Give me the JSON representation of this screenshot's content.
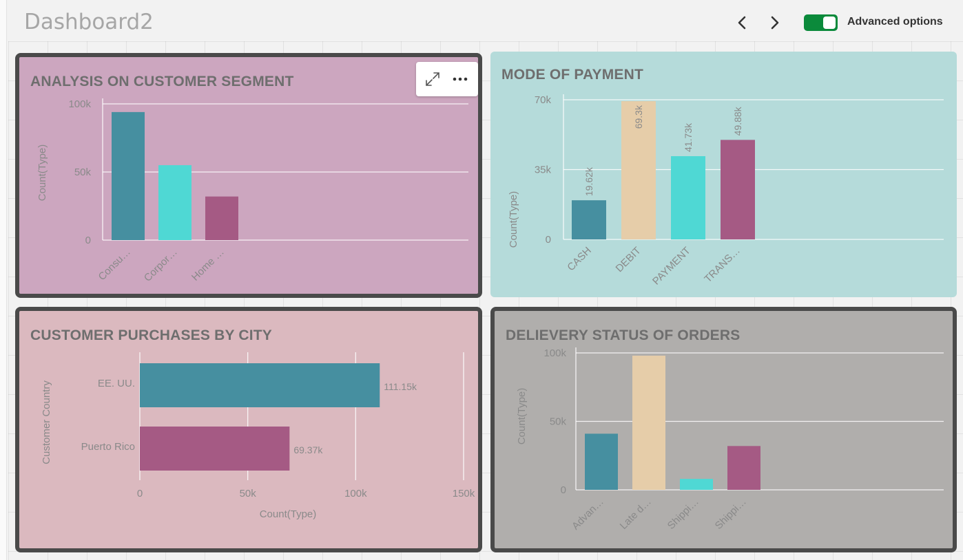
{
  "app": {
    "title": "Dashboard2",
    "advanced_options_label": "Advanced options",
    "advanced_options_on": true,
    "toggle_color": "#0b8a3b",
    "nav": {
      "prev_icon": "chevron-left-icon",
      "next_icon": "chevron-right-icon"
    }
  },
  "toolbar": {
    "expand_icon": "expand-icon",
    "more_icon": "more-horizontal-icon"
  },
  "panels": [
    {
      "id": "customer-segment",
      "title": "ANALYSIS ON CUSTOMER SEGMENT",
      "background": "#cca6bf",
      "selected": true,
      "chart_data": {
        "type": "bar",
        "title": "ANALYSIS ON CUSTOMER SEGMENT",
        "categories": [
          "Consu…",
          "Corpor…",
          "Home …"
        ],
        "values": [
          94000,
          55000,
          32000
        ],
        "colors": [
          "#468fa0",
          "#4fd8d4",
          "#a55a84"
        ],
        "ylabel": "Count(Type)",
        "xlabel": "",
        "ylim": [
          0,
          100000
        ],
        "yticks": [
          {
            "v": 0,
            "label": "0"
          },
          {
            "v": 50000,
            "label": "50k"
          },
          {
            "v": 100000,
            "label": "100k"
          }
        ],
        "data_labels": []
      }
    },
    {
      "id": "mode-of-payment",
      "title": "MODE OF PAYMENT",
      "background": "#b5dbda",
      "selected": false,
      "chart_data": {
        "type": "bar",
        "title": "MODE OF PAYMENT",
        "categories": [
          "CASH",
          "DEBIT",
          "PAYMENT",
          "TRANS…"
        ],
        "values": [
          19620,
          69300,
          41730,
          49880
        ],
        "colors": [
          "#468fa0",
          "#e6cda9",
          "#4fd8d4",
          "#a55a84"
        ],
        "ylabel": "Count(Type)",
        "xlabel": "",
        "ylim": [
          0,
          70000
        ],
        "yticks": [
          {
            "v": 0,
            "label": "0"
          },
          {
            "v": 35000,
            "label": "35k"
          },
          {
            "v": 70000,
            "label": "70k"
          }
        ],
        "data_labels": [
          "19.62k",
          "69.3k",
          "41.73k",
          "49.88k"
        ]
      }
    },
    {
      "id": "purchases-by-city",
      "title": "CUSTOMER PURCHASES BY CITY",
      "background": "#dbb9bf",
      "selected": true,
      "chart_data": {
        "type": "bar",
        "orientation": "horizontal",
        "title": "CUSTOMER PURCHASES BY CITY",
        "categories": [
          "EE. UU.",
          "Puerto Rico"
        ],
        "values": [
          111150,
          69370
        ],
        "colors": [
          "#468fa0",
          "#a55a84"
        ],
        "ylabel": "Customer Country",
        "xlabel": "Count(Type)",
        "xlim": [
          0,
          150000
        ],
        "xticks": [
          {
            "v": 0,
            "label": "0"
          },
          {
            "v": 50000,
            "label": "50k"
          },
          {
            "v": 100000,
            "label": "100k"
          },
          {
            "v": 150000,
            "label": "150k"
          }
        ],
        "data_labels": [
          "111.15k",
          "69.37k"
        ]
      }
    },
    {
      "id": "delivery-status",
      "title": "DELIEVERY STATUS OF ORDERS",
      "background": "#b0aeac",
      "selected": true,
      "chart_data": {
        "type": "bar",
        "title": "DELIEVERY STATUS OF ORDERS",
        "categories": [
          "Advan…",
          "Late d…",
          "Shippi…",
          "Shippi…"
        ],
        "values": [
          41000,
          98000,
          8000,
          32000
        ],
        "colors": [
          "#468fa0",
          "#e6cda9",
          "#4fd8d4",
          "#a55a84"
        ],
        "ylabel": "Count(Type)",
        "xlabel": "",
        "ylim": [
          0,
          100000
        ],
        "yticks": [
          {
            "v": 0,
            "label": "0"
          },
          {
            "v": 50000,
            "label": "50k"
          },
          {
            "v": 100000,
            "label": "100k"
          }
        ],
        "data_labels": []
      }
    }
  ]
}
